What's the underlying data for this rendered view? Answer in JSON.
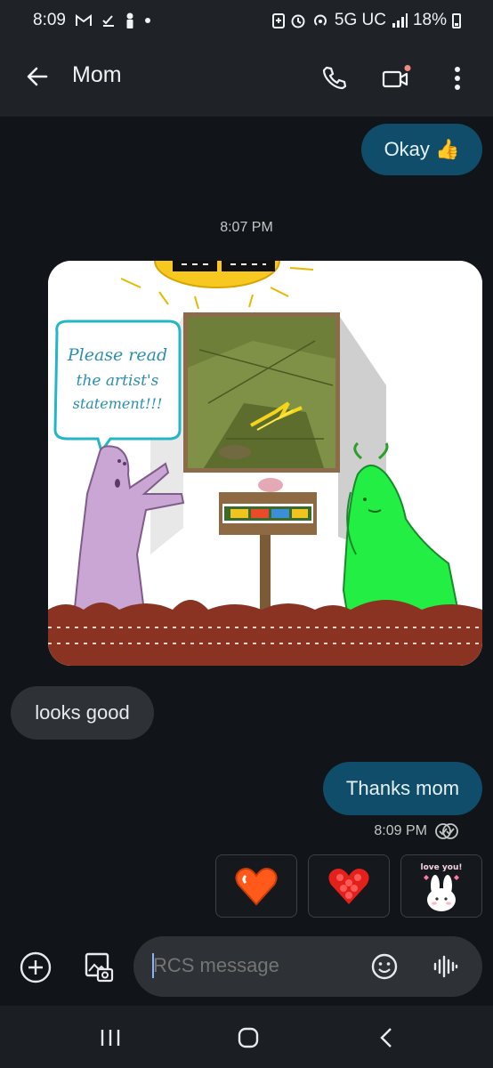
{
  "status_bar": {
    "time": "8:09",
    "network": "5G UC",
    "battery": "18%",
    "left_icons": [
      "gmail-icon",
      "check-download-icon",
      "person-icon",
      "dot-icon"
    ],
    "right_icons": [
      "battery-saver-icon",
      "alarm-icon",
      "hotspot-icon",
      "signal-icon",
      "battery-icon"
    ]
  },
  "header": {
    "contact_name": "Mom",
    "icons": [
      "back-arrow-icon",
      "phone-icon",
      "video-call-icon",
      "more-vert-icon"
    ],
    "video_badge_color": "#f28b82"
  },
  "messages": {
    "outgoing_1": "Okay 👍",
    "time_divider": "8:07 PM",
    "incoming_1": "looks good",
    "outgoing_2": "Thanks mom",
    "read_time": "8:09 PM"
  },
  "image_message": {
    "speech_bubble": [
      "Please read",
      "the artist's",
      "statement!!!"
    ]
  },
  "stickers": {
    "items": [
      "orange-heart-sticker",
      "red-heart-sticker",
      "bunny-love-sticker"
    ],
    "bunny_caption": "love you!"
  },
  "compose": {
    "placeholder": "RCS message",
    "icons": [
      "add-icon",
      "gallery-icon",
      "emoji-icon",
      "voice-icon"
    ]
  },
  "nav": {
    "icons": [
      "recents-icon",
      "home-icon",
      "back-icon"
    ]
  },
  "colors": {
    "outgoing_bubble": "#0f4d6a",
    "incoming_bubble": "#2e3135",
    "background": "#111418",
    "header": "#1f2327"
  }
}
